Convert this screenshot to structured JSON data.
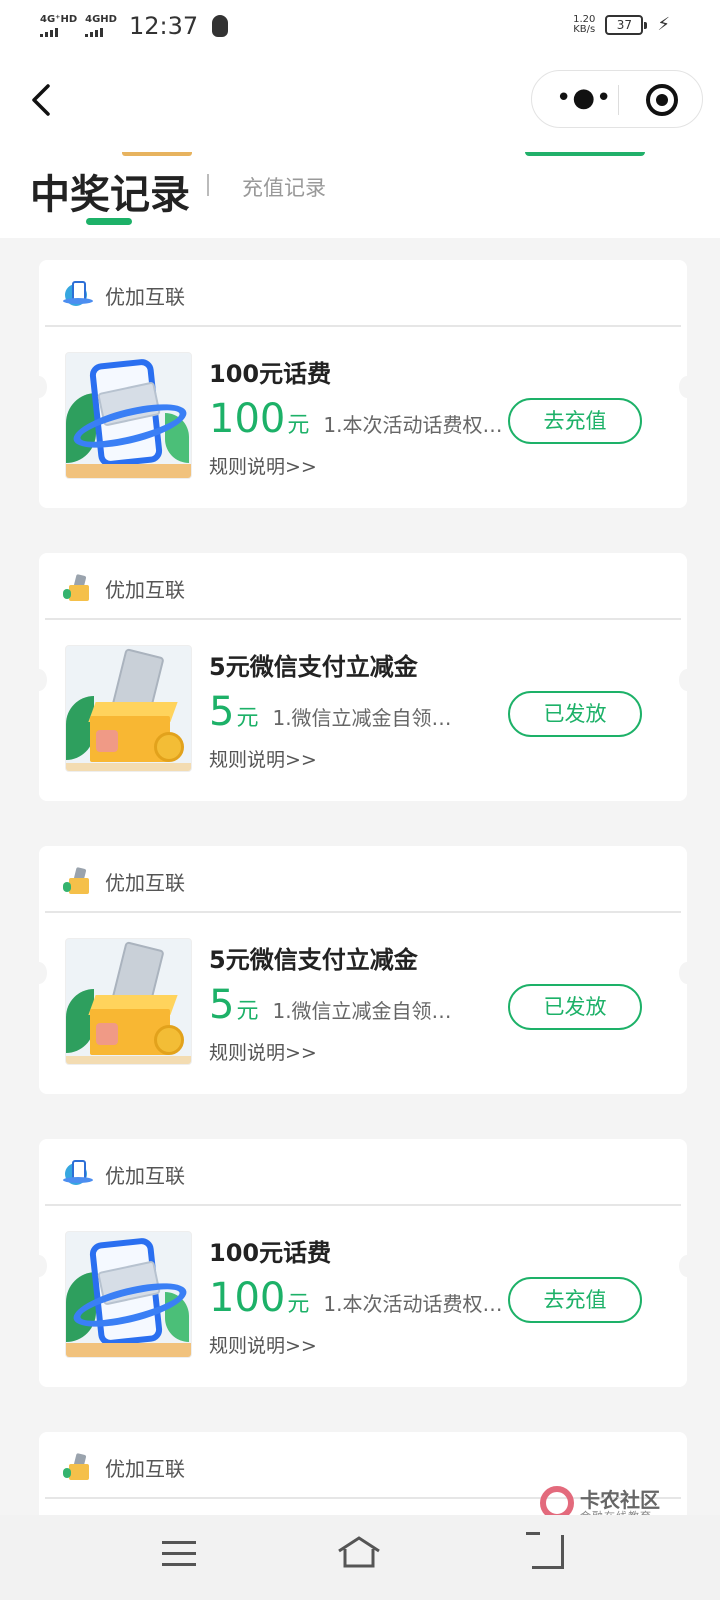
{
  "status_bar": {
    "signal_1": "4G⁺HD",
    "signal_2": "4GHD",
    "time": "12:37",
    "speed_value": "1.20",
    "speed_unit": "KB/s",
    "battery": "37"
  },
  "tabs": {
    "active": "中奖记录",
    "inactive": "充值记录"
  },
  "cards": [
    {
      "brand": "优加互联",
      "icon": "phone-recharge-icon",
      "title": "100元话费",
      "amount": "100",
      "unit": "元",
      "desc": "1.本次活动话费权…",
      "rules": "规则说明>>",
      "action": "去充值"
    },
    {
      "brand": "优加互联",
      "icon": "cashbox-icon",
      "title": "5元微信支付立减金",
      "amount": "5",
      "unit": "元",
      "desc": "1.微信立减金自领…",
      "rules": "规则说明>>",
      "action": "已发放"
    },
    {
      "brand": "优加互联",
      "icon": "cashbox-icon",
      "title": "5元微信支付立减金",
      "amount": "5",
      "unit": "元",
      "desc": "1.微信立减金自领…",
      "rules": "规则说明>>",
      "action": "已发放"
    },
    {
      "brand": "优加互联",
      "icon": "phone-recharge-icon",
      "title": "100元话费",
      "amount": "100",
      "unit": "元",
      "desc": "1.本次活动话费权…",
      "rules": "规则说明>>",
      "action": "去充值"
    },
    {
      "brand": "优加互联",
      "icon": "cashbox-icon"
    }
  ],
  "watermark": {
    "title": "卡农社区",
    "subtitle": "金融在线教育"
  },
  "colors": {
    "accent": "#1db168",
    "background": "#f4f4f4"
  }
}
